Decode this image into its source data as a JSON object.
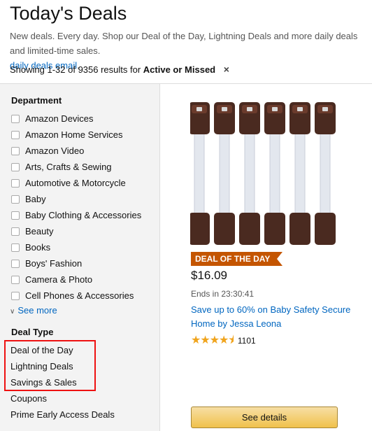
{
  "header": {
    "title": "Today's Deals",
    "subtitle_text": "New deals. Every day. Shop our Deal of the Day, Lightning Deals and more daily deals and limited-time sales.",
    "subtitle_link": "daily deals email",
    "subtitle_tail": "."
  },
  "results": {
    "prefix": "Showing 1-32 of 9356 results for",
    "filter": "Active or Missed",
    "clear": "×"
  },
  "sidebar": {
    "department_title": "Department",
    "departments": [
      "Amazon Devices",
      "Amazon Home Services",
      "Amazon Video",
      "Arts, Crafts & Sewing",
      "Automotive & Motorcycle",
      "Baby",
      "Baby Clothing & Accessories",
      "Beauty",
      "Books",
      "Boys' Fashion",
      "Camera & Photo",
      "Cell Phones & Accessories"
    ],
    "see_more": "See more",
    "deal_type_title": "Deal Type",
    "deal_types": [
      "Deal of the Day",
      "Lightning Deals",
      "Savings & Sales",
      "Coupons",
      "Prime Early Access Deals"
    ]
  },
  "product": {
    "badge": "DEAL OF THE DAY",
    "price": "$16.09",
    "ends": "Ends in 23:30:41",
    "title": "Save up to 60% on Baby Safety Secure Home by Jessa Leona",
    "rating": 4.5,
    "rating_count": "1101",
    "see_details": "See details"
  },
  "colors": {
    "link": "#0066c0",
    "badge": "#c45500",
    "star": "#f0a41d",
    "highlight": "#e11111"
  }
}
